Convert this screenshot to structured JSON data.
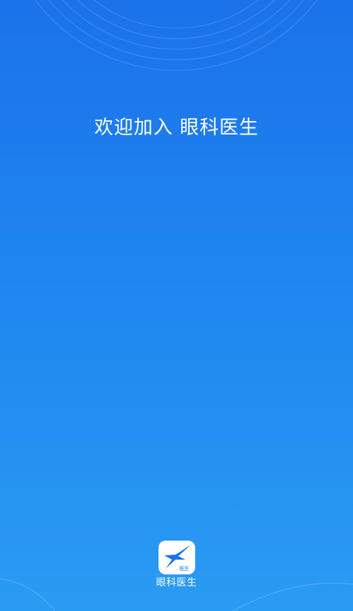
{
  "welcome": {
    "text": "欢迎加入 眼科医生"
  },
  "brand": {
    "logo_icon": "star-logo-icon",
    "logo_badge": "医生",
    "name": "眼科医生"
  },
  "colors": {
    "background_top": "#1b72ea",
    "background_bottom": "#2a9bf2",
    "text": "#ffffff"
  }
}
